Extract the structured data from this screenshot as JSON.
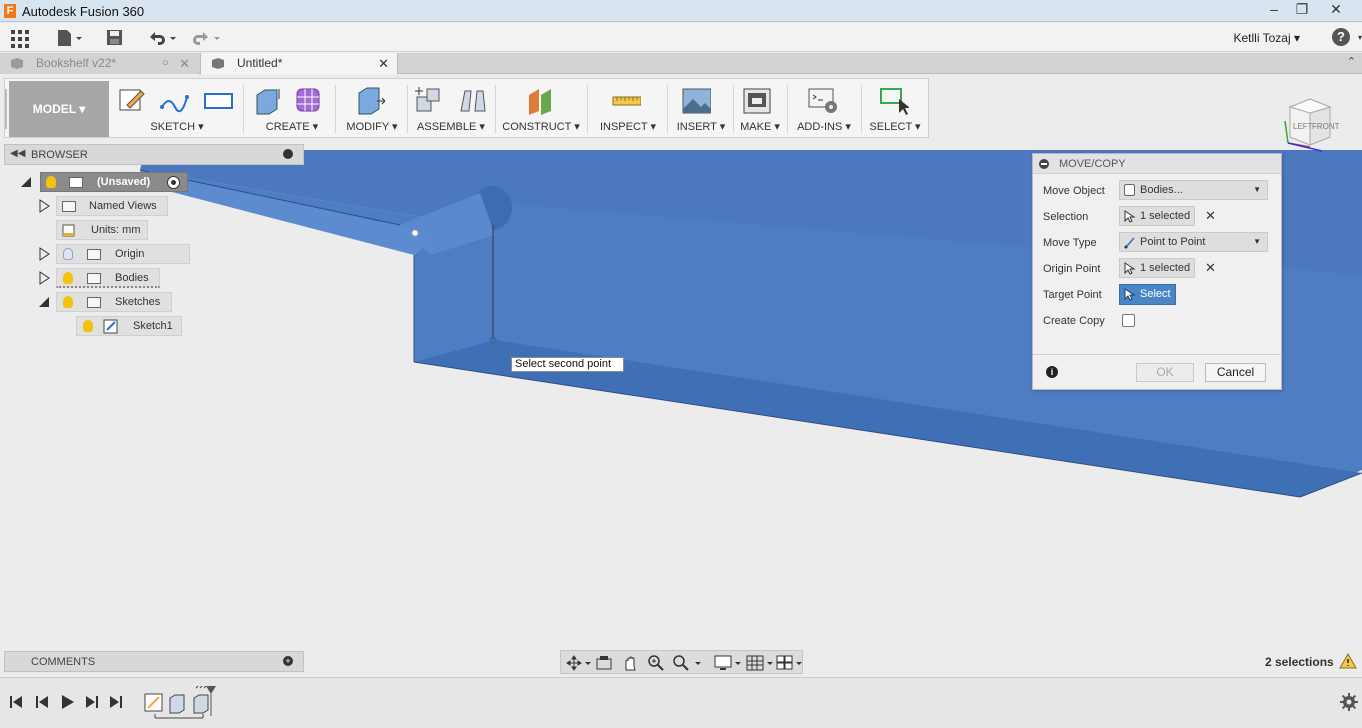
{
  "window": {
    "title": "Autodesk Fusion 360",
    "logo_letter": "F"
  },
  "appbar": {
    "user": "Ketlli Tozaj",
    "help": "?"
  },
  "tabs": [
    {
      "label": "Bookshelf v22*",
      "active": false
    },
    {
      "label": "Untitled*",
      "active": true
    }
  ],
  "ribbon": {
    "workspace": "MODEL",
    "groups": [
      "SKETCH",
      "CREATE",
      "MODIFY",
      "ASSEMBLE",
      "CONSTRUCT",
      "INSPECT",
      "INSERT",
      "MAKE",
      "ADD-INS",
      "SELECT"
    ]
  },
  "browser": {
    "title": "BROWSER",
    "root": "(Unsaved)",
    "items": {
      "named_views": "Named Views",
      "units": "Units: mm",
      "origin": "Origin",
      "bodies": "Bodies",
      "sketches": "Sketches",
      "sketch1": "Sketch1"
    }
  },
  "viewcube": {
    "left": "LEFT",
    "front": "FRONT"
  },
  "tooltip": "Select second point",
  "dialog": {
    "title": "MOVE/COPY",
    "rows": {
      "move_object_label": "Move Object",
      "move_object_value": "Bodies...",
      "selection_label": "Selection",
      "selection_value": "1 selected",
      "move_type_label": "Move Type",
      "move_type_value": "Point to Point",
      "origin_point_label": "Origin Point",
      "origin_point_value": "1 selected",
      "target_point_label": "Target Point",
      "target_point_value": "Select",
      "create_copy_label": "Create Copy"
    },
    "ok": "OK",
    "cancel": "Cancel"
  },
  "comments": {
    "title": "COMMENTS"
  },
  "status": {
    "selections": "2 selections"
  },
  "colors": {
    "body_blue": "#4a74b8",
    "accent": "#4a86c5",
    "workspace_grey": "#a6a6a6"
  }
}
